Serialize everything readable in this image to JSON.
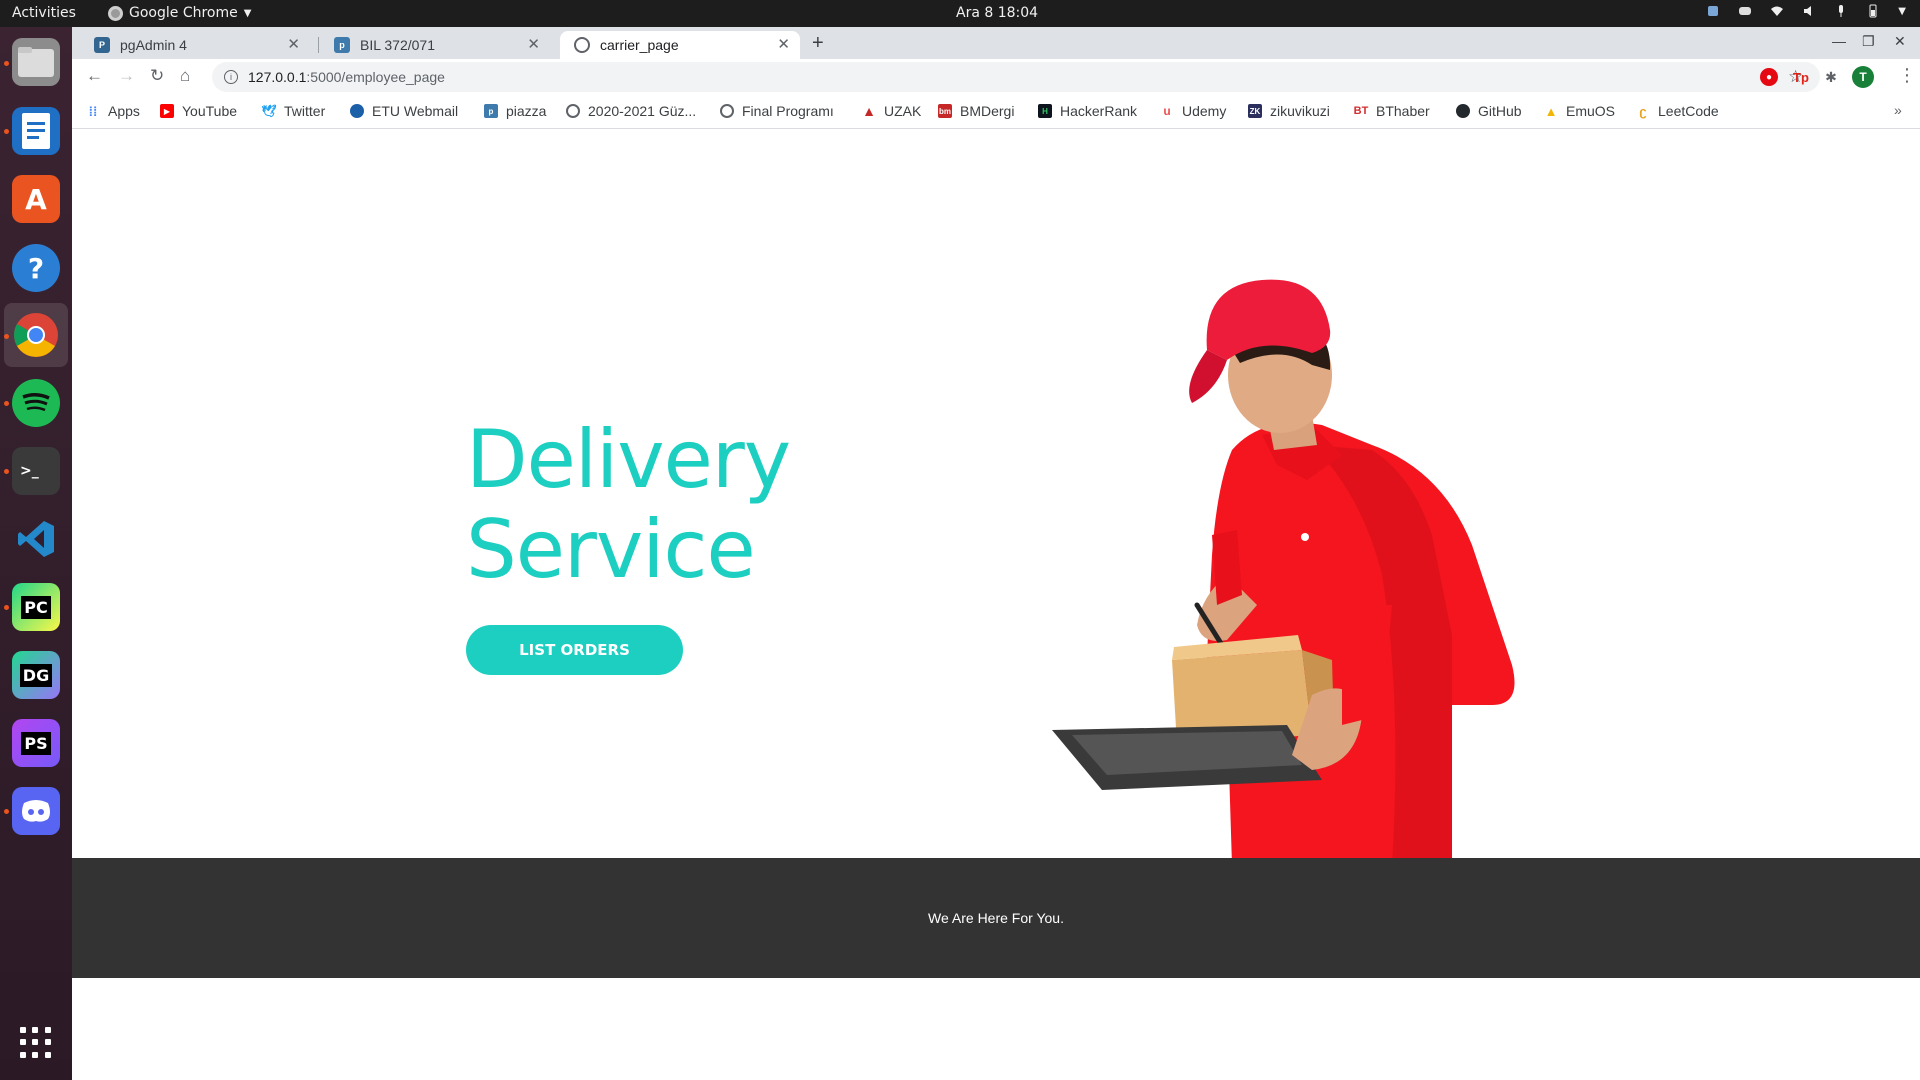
{
  "system": {
    "activities": "Activities",
    "app_name": "Google Chrome",
    "clock": "Ara 8  18:04"
  },
  "browser": {
    "tabs": [
      {
        "title": "pgAdmin 4",
        "icon": "pgadmin-icon"
      },
      {
        "title": "BIL 372/071",
        "icon": "piazza-icon"
      },
      {
        "title": "carrier_page",
        "icon": "globe-icon"
      }
    ],
    "active_tab": 2,
    "address": {
      "host": "127.0.0.1",
      "path": ":5000/employee_page"
    },
    "profile_initial": "T",
    "bookmarks": [
      {
        "label": "Apps",
        "icon": "apps-grid-icon"
      },
      {
        "label": "YouTube",
        "icon": "youtube-icon"
      },
      {
        "label": "Twitter",
        "icon": "twitter-icon"
      },
      {
        "label": "ETU Webmail",
        "icon": "etu-icon"
      },
      {
        "label": "piazza",
        "icon": "piazza-icon"
      },
      {
        "label": "2020-2021 Güz...",
        "icon": "globe-icon"
      },
      {
        "label": "Final Programı",
        "icon": "globe-icon"
      },
      {
        "label": "UZAK",
        "icon": "uzak-icon"
      },
      {
        "label": "BMDergi",
        "icon": "bmdergi-icon"
      },
      {
        "label": "HackerRank",
        "icon": "hackerrank-icon"
      },
      {
        "label": "Udemy",
        "icon": "udemy-icon"
      },
      {
        "label": "zikuvikuzi",
        "icon": "zk-icon"
      },
      {
        "label": "BThaber",
        "icon": "bthaber-icon"
      },
      {
        "label": "GitHub",
        "icon": "github-icon"
      },
      {
        "label": "EmuOS",
        "icon": "emuos-icon"
      },
      {
        "label": "LeetCode",
        "icon": "leetcode-icon"
      }
    ],
    "bookmarks_more": "»"
  },
  "page": {
    "hero_line1": "Delivery",
    "hero_line2": "Service",
    "cta_label": "LIST ORDERS",
    "footer_text": "We Are Here For You.",
    "accent_color": "#1ccfc1",
    "footer_color": "#333333"
  },
  "dock": [
    {
      "name": "files-icon"
    },
    {
      "name": "libreoffice-writer-icon"
    },
    {
      "name": "ubuntu-software-icon"
    },
    {
      "name": "help-icon"
    },
    {
      "name": "chrome-icon"
    },
    {
      "name": "spotify-icon"
    },
    {
      "name": "terminal-icon"
    },
    {
      "name": "vscode-icon"
    },
    {
      "name": "pycharm-icon"
    },
    {
      "name": "datagrip-icon"
    },
    {
      "name": "phpstorm-icon"
    },
    {
      "name": "discord-icon"
    }
  ]
}
